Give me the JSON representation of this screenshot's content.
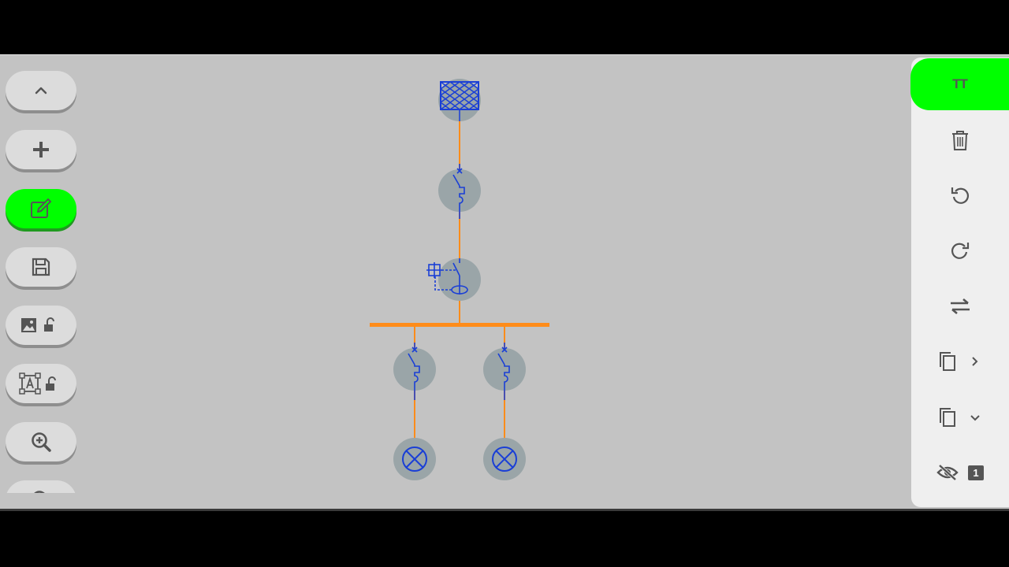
{
  "left_toolbar": {
    "buttons": [
      {
        "name": "collapse",
        "icon": "chevron-up-icon"
      },
      {
        "name": "add",
        "icon": "plus-icon"
      },
      {
        "name": "edit",
        "icon": "edit-icon",
        "active": true
      },
      {
        "name": "save",
        "icon": "save-icon"
      },
      {
        "name": "image-lock",
        "icon": "image-unlock-icon"
      },
      {
        "name": "text-lock",
        "icon": "text-box-unlock-icon"
      },
      {
        "name": "zoom-in",
        "icon": "zoom-in-icon"
      }
    ]
  },
  "right_panel": {
    "text_mode_label": "TT",
    "buttons": [
      {
        "name": "text-mode",
        "icon": "text-size-icon",
        "active": true
      },
      {
        "name": "delete",
        "icon": "trash-icon"
      },
      {
        "name": "undo",
        "icon": "undo-icon"
      },
      {
        "name": "redo",
        "icon": "redo-icon"
      },
      {
        "name": "swap",
        "icon": "swap-arrows-icon"
      },
      {
        "name": "copy-right",
        "icon": "copy-chevron-right-icon"
      },
      {
        "name": "copy-down",
        "icon": "copy-chevron-down-icon"
      },
      {
        "name": "hidden-layers",
        "icon": "eye-off-icon"
      }
    ],
    "hidden_count": "1"
  },
  "diagram": {
    "accent_color": "#ff8c1a",
    "symbol_color": "#1a3fd6",
    "node_color": "#9aa5a8",
    "components": [
      "supply-meter",
      "main-breaker",
      "rcd-switch",
      "busbar",
      "breaker-left",
      "breaker-right",
      "lamp-left",
      "lamp-right"
    ]
  },
  "colors": {
    "active_green": "#00ff00",
    "canvas_gray": "#c3c3c3"
  }
}
